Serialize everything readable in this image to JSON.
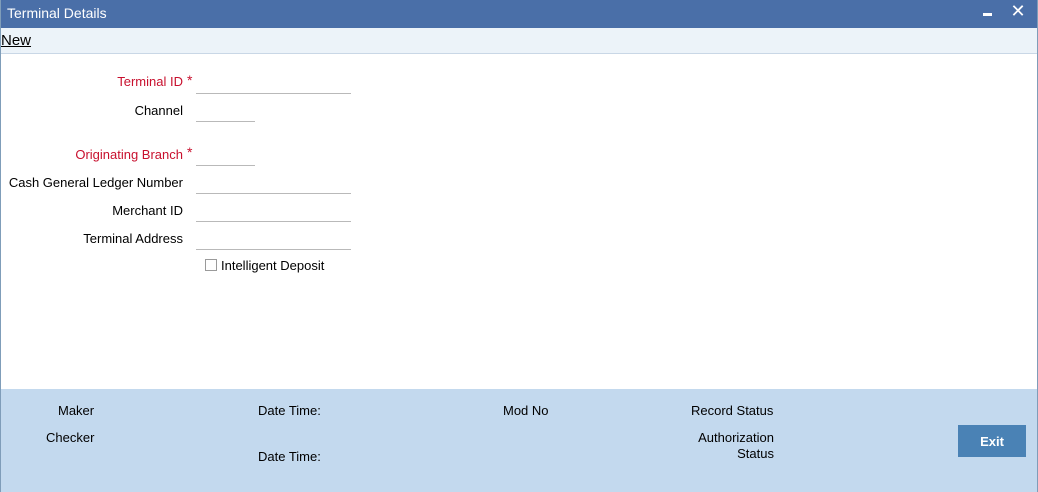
{
  "window": {
    "title": "Terminal Details",
    "minimize_label": "",
    "close_label": "✕"
  },
  "menu": {
    "new_label": "New"
  },
  "form": {
    "terminal_id_label": "Terminal ID",
    "channel_label": "Channel",
    "originating_branch_label": "Originating Branch",
    "cash_gl_label": "Cash General Ledger Number",
    "merchant_id_label": "Merchant ID",
    "terminal_address_label": "Terminal Address",
    "required_marker": "*",
    "intelligent_deposit_label": "Intelligent Deposit",
    "terminal_id_value": "",
    "channel_value": "",
    "originating_branch_value": "",
    "cash_gl_value": "",
    "merchant_id_value": "",
    "terminal_address_value": ""
  },
  "footer": {
    "maker_label": "Maker",
    "checker_label": "Checker",
    "date_time_label_1": "Date Time:",
    "date_time_label_2": "Date Time:",
    "mod_no_label": "Mod No",
    "record_status_label": "Record Status",
    "authorization_line1": "Authorization",
    "authorization_line2": "Status",
    "exit_label": "Exit"
  },
  "colors": {
    "titlebar": "#4a6fa8",
    "required_text": "#c8102e",
    "footer_bg": "#c3d9ee",
    "exit_button": "#4a82b5"
  }
}
